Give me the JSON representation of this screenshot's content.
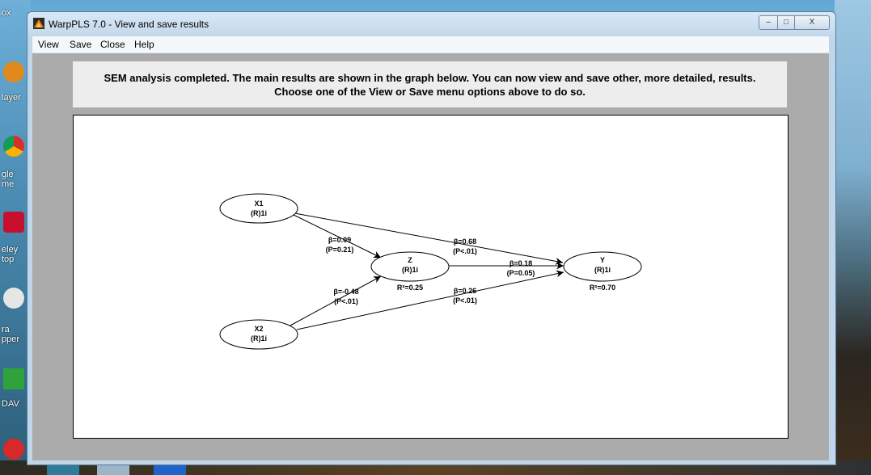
{
  "desktop": {
    "labels": [
      "ox",
      "layer",
      "gle\nme",
      "eley\ntop",
      "ra\npper",
      "DAV"
    ]
  },
  "window": {
    "title": "WarpPLS 7.0 - View and save results",
    "controls": {
      "minimize": "–",
      "maximize": "□",
      "close": "X"
    }
  },
  "menu": {
    "items": [
      "View",
      "Save",
      "Close",
      "Help"
    ]
  },
  "message": {
    "line1": "SEM analysis completed. The main results are shown in the graph below. You can now view and save other, more detailed, results.",
    "line2": "Choose one of the View or Save menu options above to do so."
  },
  "graph": {
    "nodes": [
      {
        "id": "X1",
        "name": "X1",
        "type": "(R)1i",
        "r2": ""
      },
      {
        "id": "X2",
        "name": "X2",
        "type": "(R)1i",
        "r2": ""
      },
      {
        "id": "Z",
        "name": "Z",
        "type": "(R)1i",
        "r2": "R²=0.25"
      },
      {
        "id": "Y",
        "name": "Y",
        "type": "(R)1i",
        "r2": "R²=0.70"
      }
    ],
    "paths": [
      {
        "from": "X1",
        "to": "Z",
        "beta": "β=0.09",
        "p": "(P=0.21)"
      },
      {
        "from": "X1",
        "to": "Y",
        "beta": "β=0.68",
        "p": "(P<.01)"
      },
      {
        "from": "Z",
        "to": "Y",
        "beta": "β=0.18",
        "p": "(P=0.05)"
      },
      {
        "from": "X2",
        "to": "Z",
        "beta": "β=-0.48",
        "p": "(P<.01)"
      },
      {
        "from": "X2",
        "to": "Y",
        "beta": "β=0.26",
        "p": "(P<.01)"
      }
    ]
  }
}
